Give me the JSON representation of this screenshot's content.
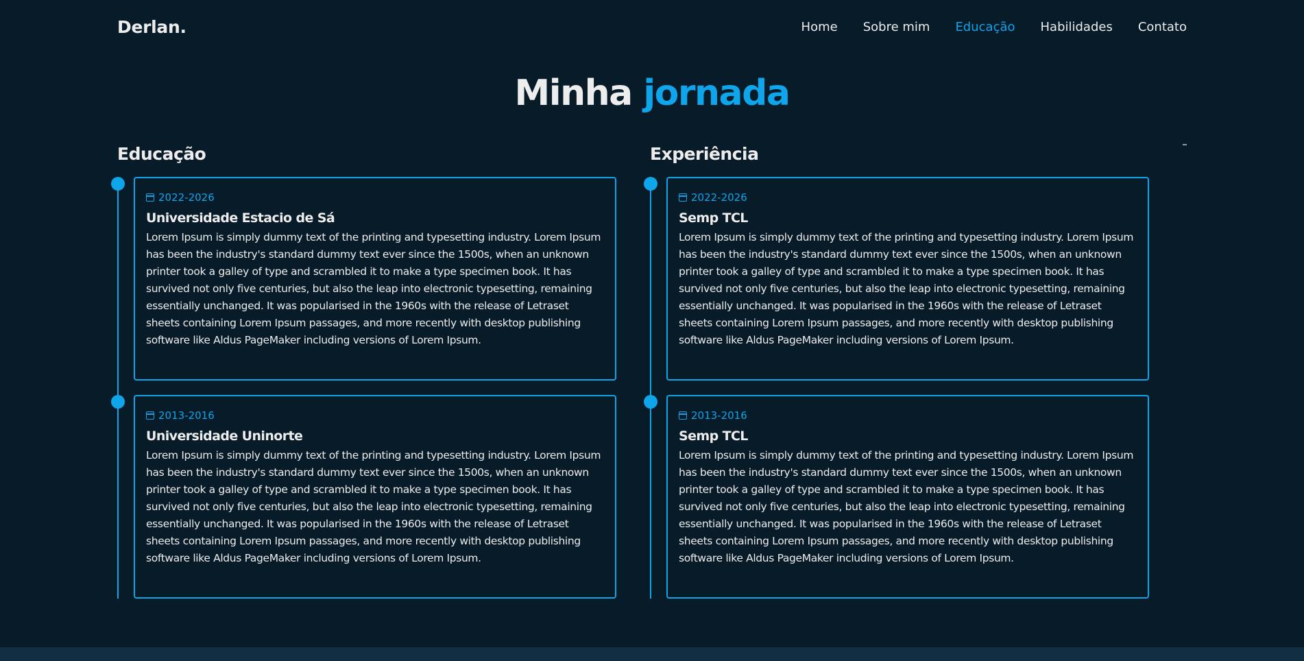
{
  "header": {
    "logo": "Derlan.",
    "nav": [
      {
        "label": "Home"
      },
      {
        "label": "Sobre mim"
      },
      {
        "label": "Educação"
      },
      {
        "label": "Habilidades"
      },
      {
        "label": "Contato"
      }
    ],
    "active_nav": "Educação"
  },
  "title": {
    "part1": "Minha",
    "part2": "jornada"
  },
  "education": {
    "heading": "Educação",
    "items": [
      {
        "date": "2022-2026",
        "title": "Universidade Estacio de Sá",
        "text": "Lorem Ipsum is simply dummy text of the printing and typesetting industry. Lorem Ipsum has been the industry's standard dummy text ever since the 1500s, when an unknown printer took a galley of type and scrambled it to make a type specimen book. It has survived not only five centuries, but also the leap into electronic typesetting, remaining essentially unchanged. It was popularised in the 1960s with the release of Letraset sheets containing Lorem Ipsum passages, and more recently with desktop publishing software like Aldus PageMaker including versions of Lorem Ipsum."
      },
      {
        "date": "2013-2016",
        "title": "Universidade Uninorte",
        "text": "Lorem Ipsum is simply dummy text of the printing and typesetting industry. Lorem Ipsum has been the industry's standard dummy text ever since the 1500s, when an unknown printer took a galley of type and scrambled it to make a type specimen book. It has survived not only five centuries, but also the leap into electronic typesetting, remaining essentially unchanged. It was popularised in the 1960s with the release of Letraset sheets containing Lorem Ipsum passages, and more recently with desktop publishing software like Aldus PageMaker including versions of Lorem Ipsum."
      }
    ]
  },
  "experience": {
    "heading": "Experiência",
    "items": [
      {
        "date": "2022-2026",
        "title": "Semp TCL",
        "text": "Lorem Ipsum is simply dummy text of the printing and typesetting industry. Lorem Ipsum has been the industry's standard dummy text ever since the 1500s, when an unknown printer took a galley of type and scrambled it to make a type specimen book. It has survived not only five centuries, but also the leap into electronic typesetting, remaining essentially unchanged. It was popularised in the 1960s with the release of Letraset sheets containing Lorem Ipsum passages, and more recently with desktop publishing software like Aldus PageMaker including versions of Lorem Ipsum."
      },
      {
        "date": "2013-2016",
        "title": "Semp TCL",
        "text": "Lorem Ipsum is simply dummy text of the printing and typesetting industry. Lorem Ipsum has been the industry's standard dummy text ever since the 1500s, when an unknown printer took a galley of type and scrambled it to make a type specimen book. It has survived not only five centuries, but also the leap into electronic typesetting, remaining essentially unchanged. It was popularised in the 1960s with the release of Letraset sheets containing Lorem Ipsum passages, and more recently with desktop publishing software like Aldus PageMaker including versions of Lorem Ipsum."
      }
    ]
  },
  "icons": {
    "date_icon": "calendar-icon",
    "timeline_marker": "timeline-dot"
  },
  "colors": {
    "background": "#081b29",
    "accent": "#0ea5ea",
    "text": "#ededed",
    "footer": "#112e42"
  }
}
